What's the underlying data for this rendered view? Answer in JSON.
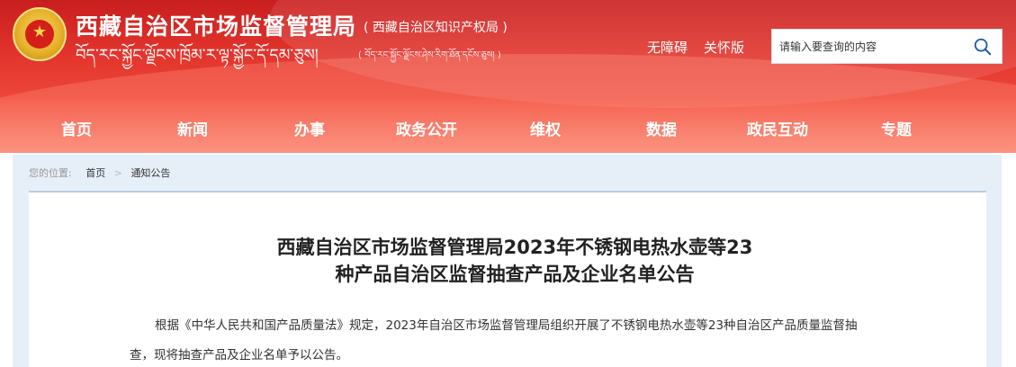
{
  "header": {
    "site_title": "西藏自治区市场监督管理局",
    "site_subtitle": "( 西藏自治区知识产权局 )",
    "tibetan_title": "བོད་རང་སྐྱོང་ལྗོངས་ཁྲོམ་ར་ལྟ་སྐྱོང་དོ་དམ་ཅུས།",
    "tibetan_subtitle": "( བོད་རང་སྐྱོང་ལྗོངས་ཤེས་རིག་ཐོན་དངོས་ཅུས། )",
    "accessibility_link": "无障碍",
    "care_link": "关怀版",
    "search_placeholder": "请输入要查询的内容",
    "emblem_icon": "national-emblem-icon",
    "search_icon": "search-icon"
  },
  "nav": {
    "items": [
      {
        "label": "首页"
      },
      {
        "label": "新闻"
      },
      {
        "label": "办事"
      },
      {
        "label": "政务公开"
      },
      {
        "label": "维权"
      },
      {
        "label": "数据"
      },
      {
        "label": "政民互动"
      },
      {
        "label": "专题"
      }
    ]
  },
  "breadcrumb": {
    "prefix": "您的位置:",
    "items": [
      {
        "label": "首页"
      },
      {
        "label": "通知公告"
      }
    ],
    "separator": ">"
  },
  "article": {
    "title_line1": "西藏自治区市场监督管理局2023年不锈钢电热水壶等23",
    "title_line2": "种产品自治区监督抽查产品及企业名单公告",
    "body": "根据《中华人民共和国产品质量法》规定，2023年自治区市场监督管理局组织开展了不锈钢电热水壶等23种自治区产品质量监督抽查，现将抽查产品及企业名单予以公告。"
  },
  "colors": {
    "header_red": "#e2342c",
    "breadcrumb_bg": "#e6eff8",
    "accent_border": "#b9cde2"
  }
}
